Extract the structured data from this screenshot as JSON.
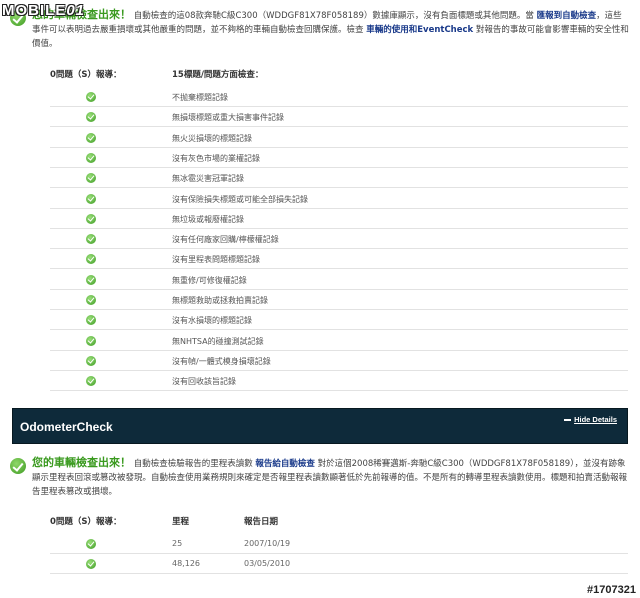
{
  "watermark": {
    "brand": "MOBILE",
    "suffix": "01"
  },
  "accident_summary": {
    "headline": "您的車輛檢查出來！",
    "body_a": "自動檢查的這08款奔馳C級C300（WDDGF81X78F058189）數據庫顯示，沒有負面標題或其他問題。當",
    "link_report": "匯報到自動檢查",
    "body_b": "，這些事件可以表明過去嚴重損壞或其他嚴重的問題，並不夠格的車輛自動檢查回購保護。檢查",
    "link_usage": "車輛的使用和EventCheck",
    "body_c": "對報告的事故可能會影響車輛的安全性和價值。"
  },
  "accident_table": {
    "col_problems": "0問題（S）報導：",
    "col_checks": "15標題/問題方面檢查：",
    "rows": [
      "不抛棄標題記錄",
      "無損壞標題或重大損害事件記錄",
      "無火災損壞的標題記錄",
      "沒有灰色市場的業權記錄",
      "無冰雹災害冠軍記錄",
      "沒有保險損失標題或可能全部損失記錄",
      "無垃圾或報廢權記錄",
      "沒有任何廠家回購/檸檬權記錄",
      "沒有里程表問題標題記錄",
      "無重修/可修復權記錄",
      "無標題救助或拯救拍賣記錄",
      "沒有水損壞的標題記錄",
      "無NHTSA的碰撞測試記錄",
      "沒有幀/一體式模身損壞記錄",
      "沒有回收該旨記錄"
    ]
  },
  "odometer_panel": {
    "title": "OdometerCheck",
    "hide_label": "Hide Details"
  },
  "odometer_summary": {
    "headline": "您的車輛檢查出來！",
    "body_a": "自動檢查檢驗報告的里程表讀數",
    "link_report": "報告給自動檢查",
    "body_b": "對於這個2008稀賽邁斯-奔馳C級C300（WDDGF81X78F058189），並沒有跡象顯示里程表回滾或篡改被發現。自動檢查使用業務規則來確定是否報里程表讀數顯著低於先前報導的值。不是所有的轉導里程表讀數使用。標題和拍賣活動報報告里程表篡改或損壞。"
  },
  "odometer_table": {
    "col_problems": "0問題（S）報導：",
    "col_mileage": "里程",
    "col_date": "報告日期",
    "rows": [
      {
        "mileage": "25",
        "date": "2007/10/19"
      },
      {
        "mileage": "48,126",
        "date": "03/05/2010"
      }
    ]
  },
  "post_number": "#1707321",
  "colors": {
    "panel_bg": "#0e2a3a",
    "ok_green": "#3a9a1f",
    "link_blue": "#1a3a8a"
  },
  "icons": {
    "status": "check-circle-icon"
  }
}
